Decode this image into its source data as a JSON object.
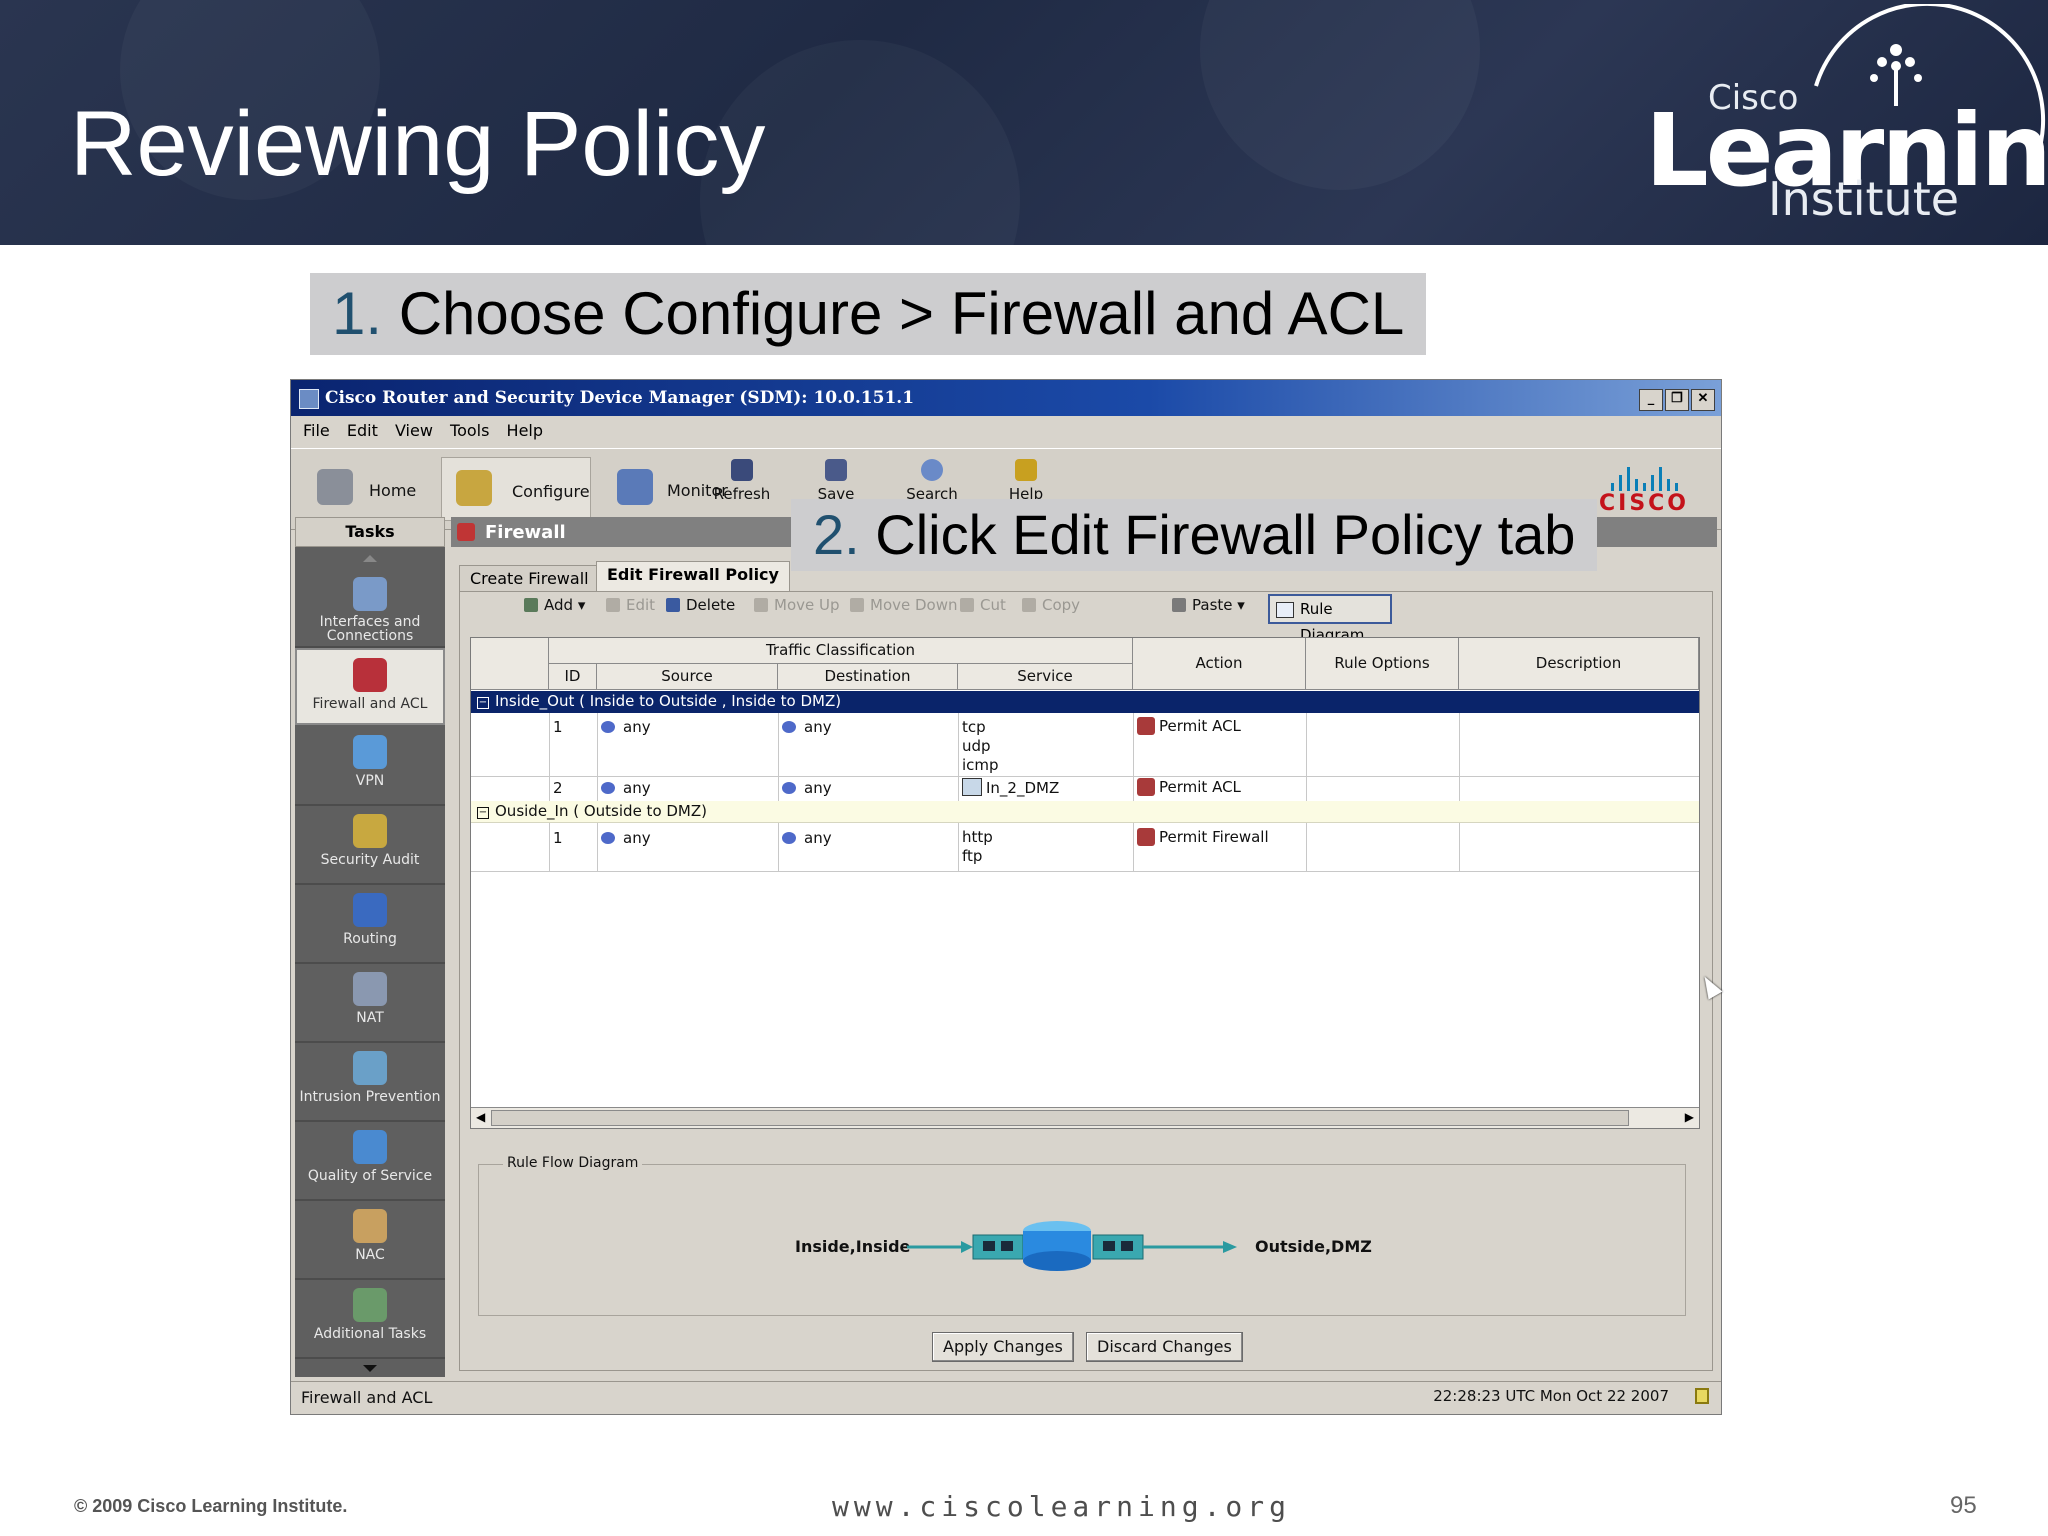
{
  "slide": {
    "title": "Reviewing Policy",
    "logo": {
      "top": "Cisco",
      "main": "Learning",
      "bottom": "Institute"
    },
    "step1": {
      "num": "1.",
      "text": " Choose Configure > Firewall and ACL"
    },
    "step2": {
      "num": "2.",
      "text": " Click Edit Firewall Policy tab"
    },
    "footer": {
      "copyright": "© 2009 Cisco Learning Institute.",
      "url": "www.ciscolearning.org",
      "page": "95"
    }
  },
  "app": {
    "window_title": "Cisco Router and Security Device Manager (SDM): 10.0.151.1",
    "menu": [
      "File",
      "Edit",
      "View",
      "Tools",
      "Help"
    ],
    "toolbar": {
      "home": "Home",
      "configure": "Configure",
      "monitor": "Monitor",
      "refresh": "Refresh",
      "save": "Save",
      "search": "Search",
      "help": "Help"
    },
    "brand": "CISCO",
    "sidebar": {
      "header": "Tasks",
      "items": [
        {
          "label": "Interfaces and Connections",
          "icon": "interfaces-icon"
        },
        {
          "label": "Firewall and ACL",
          "icon": "firewall-icon"
        },
        {
          "label": "VPN",
          "icon": "vpn-icon"
        },
        {
          "label": "Security Audit",
          "icon": "security-audit-icon"
        },
        {
          "label": "Routing",
          "icon": "routing-icon"
        },
        {
          "label": "NAT",
          "icon": "nat-icon"
        },
        {
          "label": "Intrusion Prevention",
          "icon": "intrusion-prevention-icon"
        },
        {
          "label": "Quality of Service",
          "icon": "qos-icon"
        },
        {
          "label": "NAC",
          "icon": "nac-icon"
        },
        {
          "label": "Additional Tasks",
          "icon": "additional-tasks-icon"
        }
      ]
    },
    "section_title": "Firewall",
    "tabs": [
      "Create Firewall",
      "Edit Firewall Policy"
    ],
    "panel_toolbar": {
      "add": "Add",
      "edit": "Edit",
      "delete": "Delete",
      "move_up": "Move Up",
      "move_down": "Move Down",
      "cut": "Cut",
      "copy": "Copy",
      "paste": "Paste",
      "rule_diagram": "Rule Diagram"
    },
    "table": {
      "group_header": "Traffic Classification",
      "columns": {
        "id": "ID",
        "source": "Source",
        "destination": "Destination",
        "service": "Service",
        "action": "Action",
        "rule_options": "Rule Options",
        "description": "Description"
      },
      "groups": [
        {
          "label": "Inside_Out ( Inside  to  Outside ,  Inside  to  DMZ)",
          "rows": [
            {
              "id": "1",
              "source": "any",
              "destination": "any",
              "service": [
                "tcp",
                "udp",
                "icmp"
              ],
              "action": "Permit ACL"
            },
            {
              "id": "2",
              "source": "any",
              "destination": "any",
              "service": [
                "In_2_DMZ"
              ],
              "action": "Permit ACL"
            }
          ]
        },
        {
          "label": "Ouside_In ( Outside  to  DMZ)",
          "rows": [
            {
              "id": "1",
              "source": "any",
              "destination": "any",
              "service": [
                "http",
                "ftp"
              ],
              "action": "Permit Firewall"
            }
          ]
        }
      ]
    },
    "rule_flow": {
      "title": "Rule Flow Diagram",
      "from": "Inside,Inside",
      "to": "Outside,DMZ"
    },
    "buttons": {
      "apply": "Apply Changes",
      "discard": "Discard Changes"
    },
    "status": {
      "left": "Firewall and ACL",
      "right": "22:28:23 UTC Mon Oct 22 2007"
    }
  }
}
